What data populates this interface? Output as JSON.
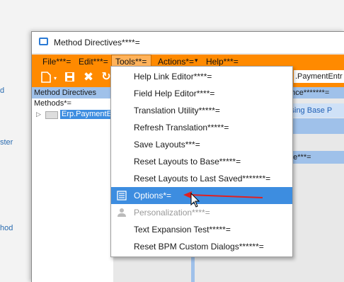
{
  "background": {
    "fragments": [
      "d",
      "ster",
      "hod"
    ]
  },
  "window": {
    "title": "Method Directives****="
  },
  "menubar": {
    "items": [
      "File***=",
      "Edit***=",
      "Tools**=",
      "Actions*=",
      "Help***="
    ]
  },
  "toolbar": {
    "icons": [
      "new-icon",
      "save-icon",
      "delete-icon",
      "refresh-icon"
    ]
  },
  "left_pane": {
    "header": "Method Directives",
    "tree_root": "Methods*=",
    "tree_item": "Erp.PaymentEntry"
  },
  "right_pane": {
    "top_field": ".PaymentEntr",
    "header": "ance*******=",
    "tabs": "ssing   Base P",
    "row": "me***="
  },
  "tools_menu": {
    "items": [
      {
        "label": "Help Link Editor****=",
        "state": "normal"
      },
      {
        "label": "Field Help Editor****=",
        "state": "normal"
      },
      {
        "label": "Translation Utility*****=",
        "state": "normal"
      },
      {
        "label": "Refresh Translation*****=",
        "state": "normal"
      },
      {
        "label": "Save Layouts***=",
        "state": "normal"
      },
      {
        "label": "Reset Layouts to Base*****=",
        "state": "normal"
      },
      {
        "label": "Reset Layouts to Last Saved*******=",
        "state": "normal"
      },
      {
        "label": "Options*=",
        "state": "highlighted",
        "icon": "options-icon"
      },
      {
        "label": "Personalization****=",
        "state": "disabled",
        "icon": "personalization-icon"
      },
      {
        "label": "Text Expansion Test*****=",
        "state": "normal"
      },
      {
        "label": "Reset BPM Custom Dialogs******=",
        "state": "normal"
      }
    ]
  },
  "colors": {
    "menubar": "#ff8a00",
    "highlight": "#3d8de0",
    "pane_header": "#9fc1ea",
    "arrow": "#e02020"
  }
}
